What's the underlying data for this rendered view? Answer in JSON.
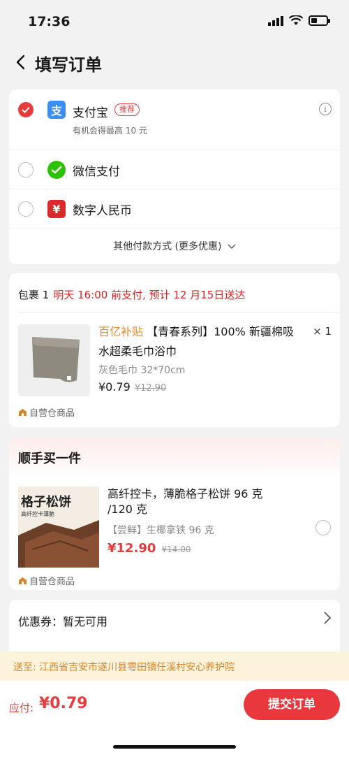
{
  "status_bar": {
    "time": "17:36"
  },
  "nav": {
    "title": "填写订单"
  },
  "payment": {
    "options": [
      {
        "name": "支付宝",
        "badge": "推荐",
        "sub": "有机会得最高 10 元",
        "selected": true,
        "icon": "alipay-icon",
        "color": "#3b8ff0"
      },
      {
        "name": "微信支付",
        "selected": false,
        "icon": "wechat-pay-icon",
        "color": "#2dc100"
      },
      {
        "name": "数字人民币",
        "selected": false,
        "icon": "digital-rmb-icon",
        "color": "#d92b2b"
      }
    ],
    "more": "其他付款方式 (更多优惠)"
  },
  "package": {
    "label": "包裹 1",
    "note": "明天 16:00 前支付, 预计 12 月15日送达",
    "product": {
      "tag": "百亿补贴",
      "title": "【青春系列】100% 新疆棉吸水超柔毛巾浴巾",
      "qty": "× 1",
      "spec": "灰色毛巾 32*70cm",
      "price": "¥0.79",
      "orig_price": "¥12.90"
    },
    "self_operated": "自营仓商品"
  },
  "upsell": {
    "title": "顺手买一件",
    "image_title": "格子松饼",
    "image_sub": "高纤控卡薄脆",
    "name": "高纤控卡，薄脆格子松饼 96 克 /120 克",
    "spec": "【尝鲜】生椰拿铁 96 克",
    "price": "¥12.90",
    "orig_price": "¥14.00",
    "self_operated": "自营仓商品"
  },
  "coupon": {
    "label": "优惠券：暂无可用"
  },
  "address": {
    "text": "送至: 江西省吉安市遂川县雩田镇任溪村安心养护院"
  },
  "footer": {
    "total_label": "应付:",
    "total_value": "¥0.79",
    "submit": "提交订单"
  },
  "colors": {
    "accent": "#e63c3c",
    "orange": "#e38b2e"
  }
}
